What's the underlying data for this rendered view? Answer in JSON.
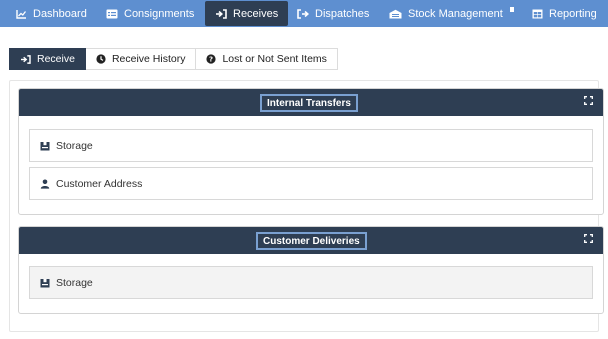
{
  "nav": {
    "items": [
      {
        "label": "Dashboard",
        "icon": "chart-line-icon"
      },
      {
        "label": "Consignments",
        "icon": "list-card-icon"
      },
      {
        "label": "Receives",
        "icon": "sign-in-icon"
      },
      {
        "label": "Dispatches",
        "icon": "sign-out-icon"
      },
      {
        "label": "Stock Management",
        "icon": "warehouse-icon"
      },
      {
        "label": "Reporting",
        "icon": "table-icon"
      }
    ],
    "active": "Receives"
  },
  "tabs": {
    "items": [
      {
        "label": "Receive",
        "icon": "sign-in-icon"
      },
      {
        "label": "Receive History",
        "icon": "clock-icon"
      },
      {
        "label": "Lost or Not Sent Items",
        "icon": "question-circle-icon"
      }
    ],
    "active": "Receive"
  },
  "panels": [
    {
      "title": "Internal Transfers",
      "rows": [
        {
          "label": "Storage",
          "icon": "box-icon"
        },
        {
          "label": "Customer Address",
          "icon": "user-icon"
        }
      ]
    },
    {
      "title": "Customer Deliveries",
      "rows": [
        {
          "label": "Storage",
          "icon": "box-icon"
        }
      ]
    }
  ],
  "colors": {
    "nav_bg": "#5e8fd0",
    "dark": "#2e3e53",
    "title_border": "#7aa0d1"
  }
}
